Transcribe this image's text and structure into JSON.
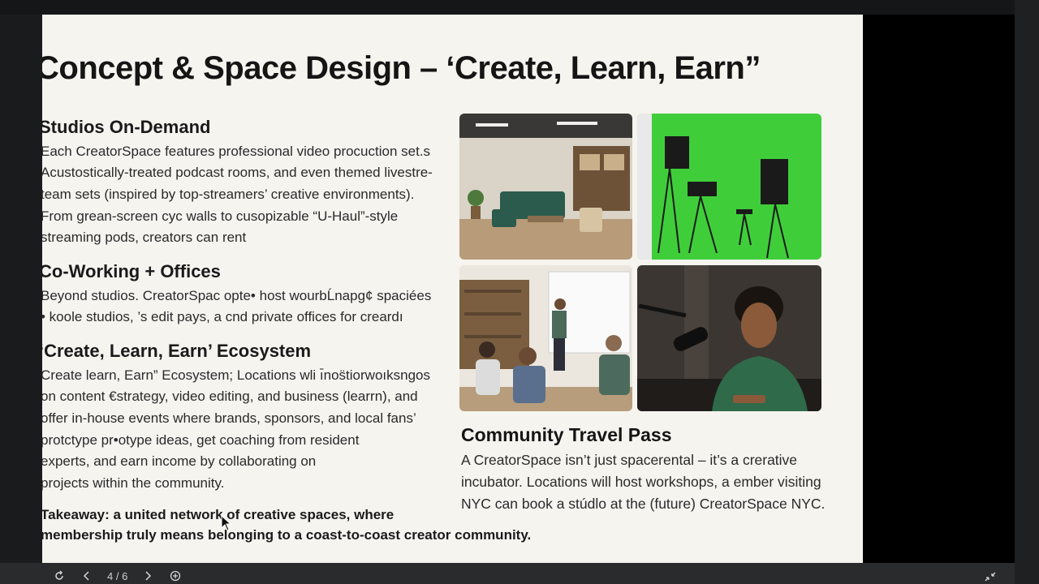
{
  "slide": {
    "title": "Concept & Space Design – ‘Create, Learn, Earn”",
    "sections": [
      {
        "heading": "Studios On-Demand",
        "lines": [
          "Each CreatorSpace features professional video procuction set.s",
          "Acustostically-treated podcast rooms, and even themed livestre-",
          "team sets (inspired by top-streamers’ creative environments).",
          "From grean-screen cyc walls to cusopizable “U-Haul”-style",
          "streaming pods, creators can rent"
        ]
      },
      {
        "heading": "Co-Working + Offices",
        "lines": [
          "Beyond studios. CreatorSpac opte• host wourbĹnapg¢ spaciées",
          "• koole studios, ’s edit pays, a cnd private offices for creardı"
        ]
      },
      {
        "heading": "‘Create, Learn, Earn’ Ecosystem",
        "lines": [
          "Create learn, Earn” Ecosystem; Locations wli ı̄nos̈tiorwoıksngos",
          "on content €strategy, video editing, and business (learrn), and",
          "offer in-house events where brands, sponsors, and local fans’",
          "protctype pr•otype ideas, get coaching from resident",
          "experts, and earn income by collaborating on",
          "projects within the community."
        ]
      }
    ],
    "takeaway": [
      "Takeaway: a united network of creative spaces, where",
      "membership truly means belonging to a coast-to-coast creator community."
    ],
    "community": {
      "heading": "Community Travel Pass",
      "lines": [
        "A CreatorSpace isn’t just spacerental – it’s a crerative",
        "incubator. Locations will host workshops, a ember visiting",
        "NYC can book a stúdlo at the (future) CreatorSpace NYC."
      ]
    }
  },
  "viewer": {
    "page_indicator": "4 / 6",
    "icons": [
      "rotate-icon",
      "prev-page-icon",
      "next-page-icon",
      "zoom-in-icon",
      "exit-fullscreen-icon"
    ]
  },
  "colors": {
    "slide_bg": "#f6f4ef",
    "green_screen": "#3fce3a",
    "viewer_bg": "#1b1c1e"
  }
}
